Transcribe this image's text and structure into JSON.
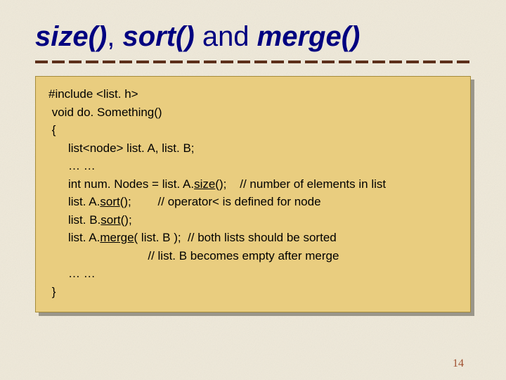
{
  "title": {
    "size": "size()",
    "sep1": ", ",
    "sort": "sort()",
    "and": " and ",
    "merge": "merge()"
  },
  "code": {
    "l1": "#include <list. h>",
    "l2": " void do. Something()",
    "l3": " {",
    "l4": "list<node> list. A, list. B;",
    "l5": "… …",
    "l6a": "int num. Nodes = list. A.",
    "l6b": "size",
    "l6c": "();    // number of elements in list",
    "l7a": "list. A.",
    "l7b": "sort",
    "l7c": "();        // operator< is defined for node",
    "l8a": "list. B.",
    "l8b": "sort",
    "l8c": "();",
    "l9a": "list. A.",
    "l9b": "merge",
    "l9c": "( list. B );  // both lists should be sorted",
    "l10": "                        // list. B becomes empty after merge",
    "l11": "… …",
    "l12": " }"
  },
  "pagenum": "14"
}
